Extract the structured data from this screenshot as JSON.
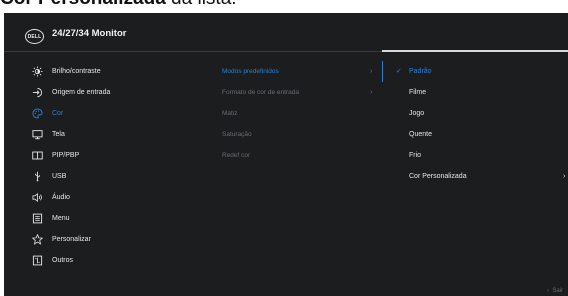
{
  "caption": {
    "bold": "Cor Personalizada",
    "rest": " da lista."
  },
  "header": {
    "logo_text": "DELL",
    "title": "24/27/34 Monitor"
  },
  "menu": [
    {
      "label": "Brilho/contraste",
      "icon": "sun-icon"
    },
    {
      "label": "Origem de entrada",
      "icon": "input-source-icon"
    },
    {
      "label": "Cor",
      "icon": "palette-icon"
    },
    {
      "label": "Tela",
      "icon": "display-icon"
    },
    {
      "label": "PIP/PBP",
      "icon": "pip-pbp-icon"
    },
    {
      "label": "USB",
      "icon": "usb-icon"
    },
    {
      "label": "Áudio",
      "icon": "speaker-icon"
    },
    {
      "label": "Menu",
      "icon": "menu-icon"
    },
    {
      "label": "Personalizar",
      "icon": "star-icon"
    },
    {
      "label": "Outros",
      "icon": "others-icon"
    }
  ],
  "active_menu": "Cor",
  "submenu": [
    {
      "label": "Modos predefinidos",
      "chevron": "›"
    },
    {
      "label": "Formato de cor de entrada",
      "chevron": "›"
    },
    {
      "label": "Matiz"
    },
    {
      "label": "Saturação"
    },
    {
      "label": "Redef cor"
    }
  ],
  "options": [
    {
      "label": "Padrão",
      "check": "✓"
    },
    {
      "label": "Filme"
    },
    {
      "label": "Jogo"
    },
    {
      "label": "Quente"
    },
    {
      "label": "Frio"
    },
    {
      "label": "Cor Personalizada",
      "chevron": "›"
    }
  ],
  "exit": {
    "chevron": "‹",
    "label": "Sair"
  },
  "colors": {
    "accent": "#2f7ed8",
    "background": "#1b1d1f",
    "text": "#e6e6e6",
    "muted": "#6a6d70"
  }
}
